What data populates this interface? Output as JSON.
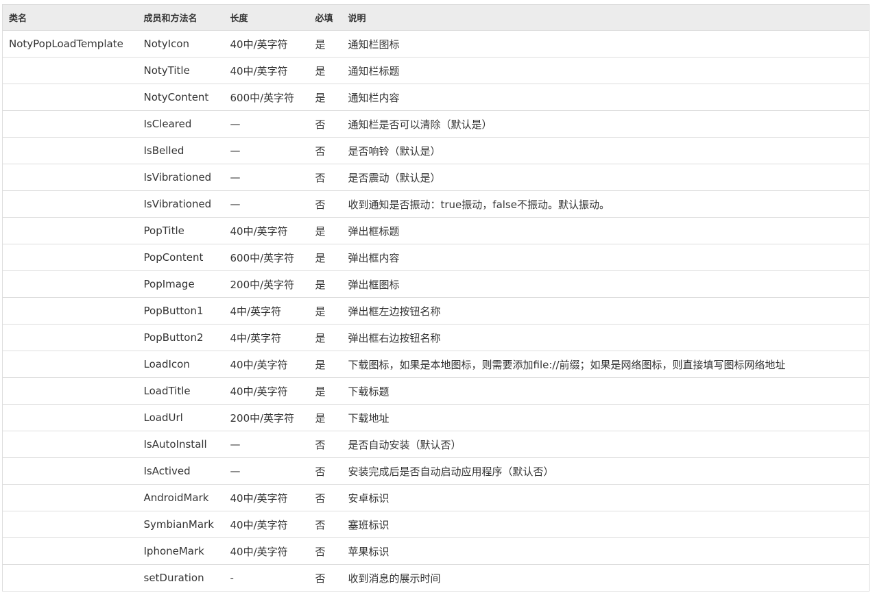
{
  "table": {
    "headers": [
      "类名",
      "成员和方法名",
      "长度",
      "必填",
      "说明"
    ],
    "rows": [
      {
        "class": "NotyPopLoadTemplate",
        "member": "NotyIcon",
        "length": "40中/英字符",
        "required": "是",
        "desc": "通知栏图标"
      },
      {
        "class": "",
        "member": "NotyTitle",
        "length": "40中/英字符",
        "required": "是",
        "desc": "通知栏标题"
      },
      {
        "class": "",
        "member": "NotyContent",
        "length": "600中/英字符",
        "required": "是",
        "desc": "通知栏内容"
      },
      {
        "class": "",
        "member": "IsCleared",
        "length": "—",
        "required": "否",
        "desc": "通知栏是否可以清除（默认是）"
      },
      {
        "class": "",
        "member": "IsBelled",
        "length": "—",
        "required": "否",
        "desc": "是否响铃（默认是）"
      },
      {
        "class": "",
        "member": "IsVibrationed",
        "length": "—",
        "required": "否",
        "desc": "是否震动（默认是）"
      },
      {
        "class": "",
        "member": "IsVibrationed",
        "length": "—",
        "required": "否",
        "desc": "收到通知是否振动：true振动，false不振动。默认振动。"
      },
      {
        "class": "",
        "member": "PopTitle",
        "length": "40中/英字符",
        "required": "是",
        "desc": "弹出框标题"
      },
      {
        "class": "",
        "member": "PopContent",
        "length": "600中/英字符",
        "required": "是",
        "desc": "弹出框内容"
      },
      {
        "class": "",
        "member": "PopImage",
        "length": "200中/英字符",
        "required": "是",
        "desc": "弹出框图标"
      },
      {
        "class": "",
        "member": "PopButton1",
        "length": "4中/英字符",
        "required": "是",
        "desc": "弹出框左边按钮名称"
      },
      {
        "class": "",
        "member": "PopButton2",
        "length": "4中/英字符",
        "required": "是",
        "desc": "弹出框右边按钮名称"
      },
      {
        "class": "",
        "member": "LoadIcon",
        "length": "40中/英字符",
        "required": "是",
        "desc": "下载图标，如果是本地图标，则需要添加file://前缀；如果是网络图标，则直接填写图标网络地址"
      },
      {
        "class": "",
        "member": "LoadTitle",
        "length": "40中/英字符",
        "required": "是",
        "desc": "下载标题"
      },
      {
        "class": "",
        "member": "LoadUrl",
        "length": "200中/英字符",
        "required": "是",
        "desc": "下载地址"
      },
      {
        "class": "",
        "member": "IsAutoInstall",
        "length": "—",
        "required": "否",
        "desc": "是否自动安装（默认否）"
      },
      {
        "class": "",
        "member": "IsActived",
        "length": "—",
        "required": "否",
        "desc": "安装完成后是否自动启动应用程序（默认否）"
      },
      {
        "class": "",
        "member": "AndroidMark",
        "length": "40中/英字符",
        "required": "否",
        "desc": "安卓标识"
      },
      {
        "class": "",
        "member": "SymbianMark",
        "length": "40中/英字符",
        "required": "否",
        "desc": "塞班标识"
      },
      {
        "class": "",
        "member": "IphoneMark",
        "length": "40中/英字符",
        "required": "否",
        "desc": "苹果标识"
      },
      {
        "class": "",
        "member": "setDuration",
        "length": "-",
        "required": "否",
        "desc": "收到消息的展示时间"
      }
    ]
  }
}
